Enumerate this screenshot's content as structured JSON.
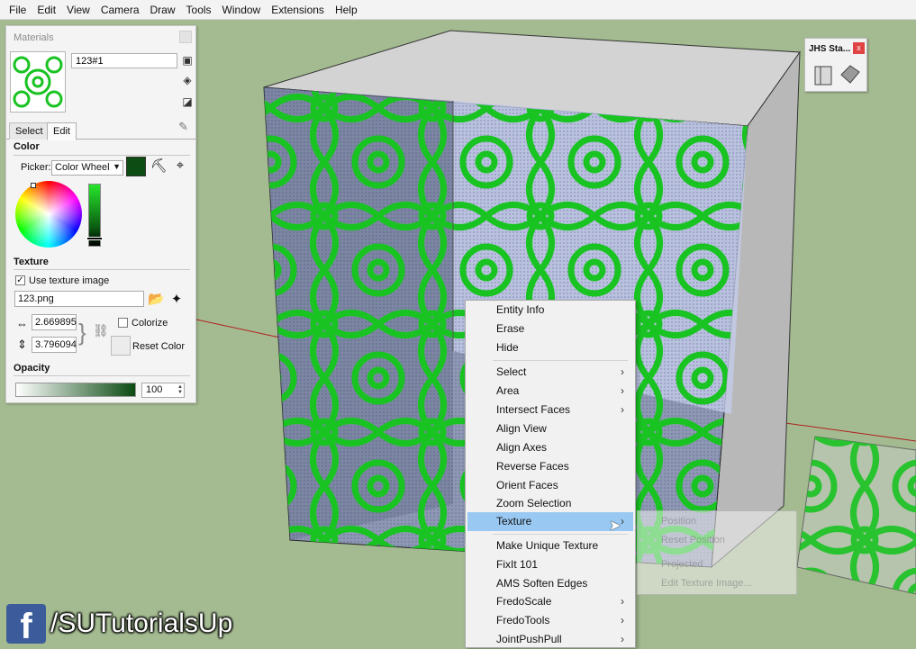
{
  "menu": [
    "File",
    "Edit",
    "View",
    "Camera",
    "Draw",
    "Tools",
    "Window",
    "Extensions",
    "Help"
  ],
  "materials": {
    "title": "Materials",
    "name": "123#1",
    "tabs": {
      "select": "Select",
      "edit": "Edit"
    },
    "color_section": "Color",
    "picker_label": "Picker:",
    "picker_value": "Color Wheel",
    "current_color": "#0d4d14",
    "texture_section": "Texture",
    "use_texture_label": "Use texture image",
    "use_texture_checked": true,
    "texture_file": "123.png",
    "width_value": "2.669895",
    "height_value": "3.796094",
    "colorize_label": "Colorize",
    "reset_color_label": "Reset Color",
    "opacity_section": "Opacity",
    "opacity_value": "100"
  },
  "jhs": {
    "title": "JHS Sta...",
    "close": "x"
  },
  "context_menu": {
    "items": [
      {
        "label": "Entity Info",
        "submenu": false
      },
      {
        "label": "Erase",
        "submenu": false
      },
      {
        "label": "Hide",
        "submenu": false
      },
      {
        "label": "Select",
        "submenu": true
      },
      {
        "label": "Area",
        "submenu": true
      },
      {
        "label": "Intersect Faces",
        "submenu": true
      },
      {
        "label": "Align View",
        "submenu": false
      },
      {
        "label": "Align Axes",
        "submenu": false
      },
      {
        "label": "Reverse Faces",
        "submenu": false
      },
      {
        "label": "Orient Faces",
        "submenu": false
      },
      {
        "label": "Zoom Selection",
        "submenu": false
      },
      {
        "label": "Texture",
        "submenu": true,
        "active": true
      },
      {
        "label": "Make Unique Texture",
        "submenu": false
      },
      {
        "label": "FixIt 101",
        "submenu": false
      },
      {
        "label": "AMS Soften Edges",
        "submenu": false
      },
      {
        "label": "FredoScale",
        "submenu": true
      },
      {
        "label": "FredoTools",
        "submenu": true
      },
      {
        "label": "JointPushPull",
        "submenu": true
      }
    ],
    "chevron": "›"
  },
  "texture_submenu": [
    "Position",
    "Reset Position",
    "Projected",
    "Edit Texture Image..."
  ],
  "branding": {
    "fb": "f",
    "handle": "/SUTutorialsUp"
  },
  "colors": {
    "background": "#a4bb91",
    "pattern_green": "#19c322",
    "menu_highlight": "#99c9f2"
  }
}
